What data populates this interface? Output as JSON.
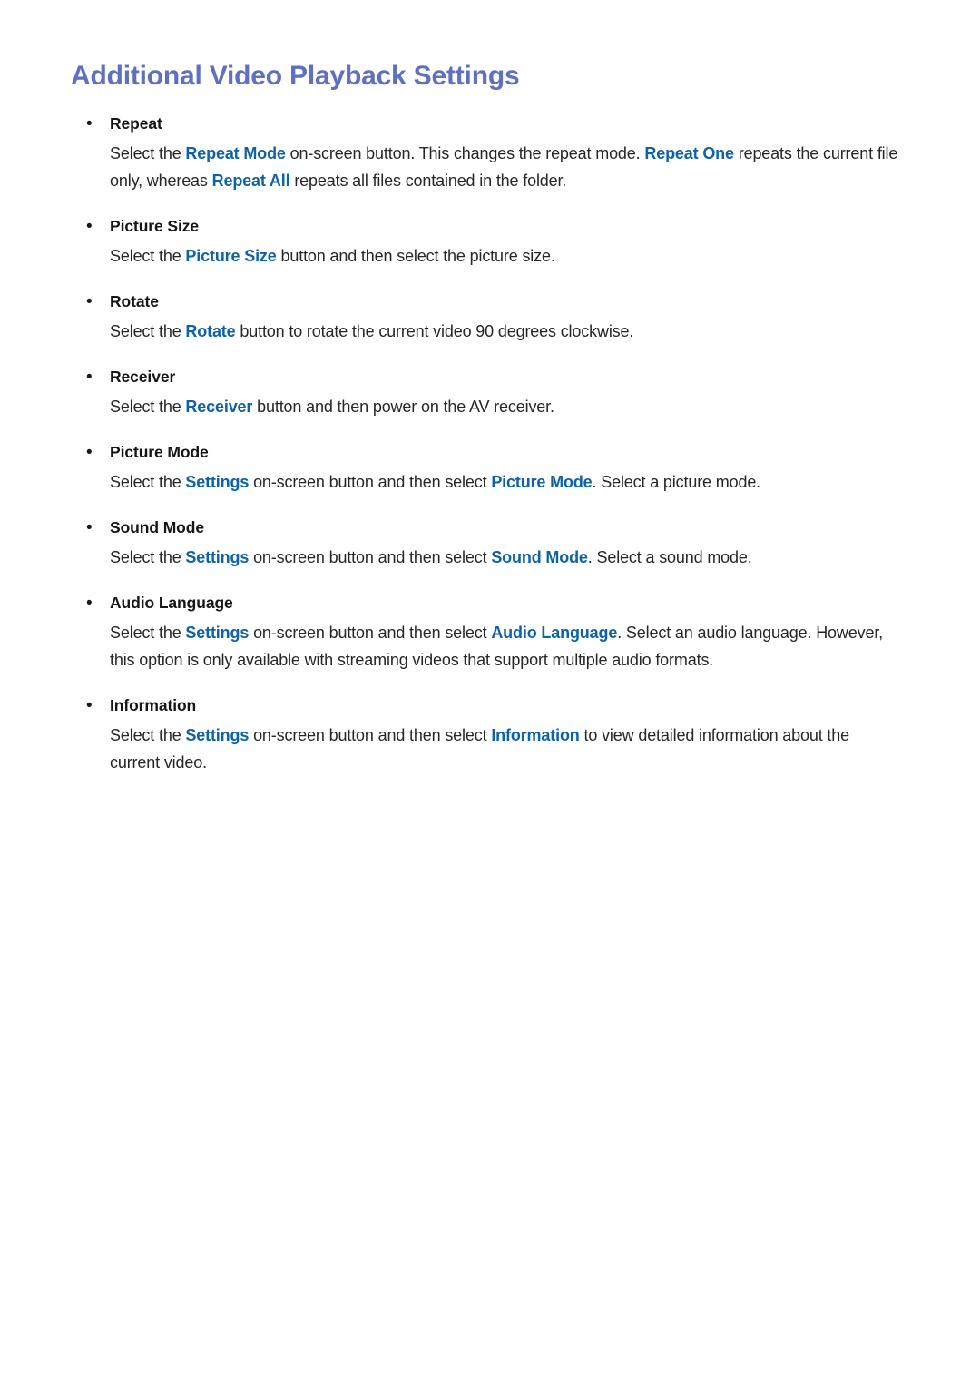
{
  "page": {
    "title": "Additional Video Playback Settings",
    "background_color": "#ffffff",
    "title_color": "#5f70c3",
    "term_color": "#0d62ab",
    "body_color": "#272727",
    "bullet_glyph": "•"
  },
  "sections": [
    {
      "label": "Repeat",
      "paragraph_parts": [
        {
          "text": "Select the ",
          "type": "plain"
        },
        {
          "text": "Repeat Mode",
          "type": "term"
        },
        {
          "text": " on-screen button. This changes the repeat mode. ",
          "type": "plain"
        },
        {
          "text": "Repeat One",
          "type": "term"
        },
        {
          "text": " repeats the current file only, whereas ",
          "type": "plain"
        },
        {
          "text": "Repeat All",
          "type": "term"
        },
        {
          "text": " repeats all files contained in the folder.",
          "type": "plain"
        }
      ],
      "paragraph_text": "Select the Repeat Mode on-screen button. This changes the repeat mode. Repeat One repeats the current file only, whereas Repeat All repeats all files contained in the folder."
    },
    {
      "label": "Picture Size",
      "paragraph_parts": [
        {
          "text": "Select the ",
          "type": "plain"
        },
        {
          "text": "Picture Size",
          "type": "term"
        },
        {
          "text": " button and then select the picture size.",
          "type": "plain"
        }
      ],
      "paragraph_text": "Select the Picture Size button and then select the picture size."
    },
    {
      "label": "Rotate",
      "paragraph_parts": [
        {
          "text": "Select the ",
          "type": "plain"
        },
        {
          "text": "Rotate",
          "type": "term"
        },
        {
          "text": " button to rotate the current video 90 degrees clockwise.",
          "type": "plain"
        }
      ],
      "paragraph_text": "Select the Rotate button to rotate the current video 90 degrees clockwise."
    },
    {
      "label": "Receiver",
      "paragraph_parts": [
        {
          "text": "Select the ",
          "type": "plain"
        },
        {
          "text": "Receiver",
          "type": "term"
        },
        {
          "text": " button and then power on the AV receiver.",
          "type": "plain"
        }
      ],
      "paragraph_text": "Select the Receiver button and then power on the AV receiver."
    },
    {
      "label": "Picture Mode",
      "paragraph_parts": [
        {
          "text": "Select the ",
          "type": "plain"
        },
        {
          "text": "Settings",
          "type": "term"
        },
        {
          "text": " on-screen button and then select ",
          "type": "plain"
        },
        {
          "text": "Picture Mode",
          "type": "term"
        },
        {
          "text": ". Select a picture mode.",
          "type": "plain"
        }
      ],
      "paragraph_text": "Select the Settings on-screen button and then select Picture Mode. Select a picture mode."
    },
    {
      "label": "Sound Mode",
      "paragraph_parts": [
        {
          "text": "Select the ",
          "type": "plain"
        },
        {
          "text": "Settings",
          "type": "term"
        },
        {
          "text": " on-screen button and then select ",
          "type": "plain"
        },
        {
          "text": "Sound Mode",
          "type": "term"
        },
        {
          "text": ". Select a sound mode.",
          "type": "plain"
        }
      ],
      "paragraph_text": "Select the Settings on-screen button and then select Sound Mode. Select a sound mode."
    },
    {
      "label": "Audio Language",
      "paragraph_parts": [
        {
          "text": "Select the ",
          "type": "plain"
        },
        {
          "text": "Settings",
          "type": "term"
        },
        {
          "text": " on-screen button and then select ",
          "type": "plain"
        },
        {
          "text": "Audio Language",
          "type": "term"
        },
        {
          "text": ". Select an audio language. However, this option is only available with streaming videos that support multiple audio formats.",
          "type": "plain"
        }
      ],
      "paragraph_text": "Select the Settings on-screen button and then select Audio Language. Select an audio language. However, this option is only available with streaming videos that support multiple audio formats."
    },
    {
      "label": "Information",
      "paragraph_parts": [
        {
          "text": "Select the ",
          "type": "plain"
        },
        {
          "text": "Settings",
          "type": "term"
        },
        {
          "text": " on-screen button and then select ",
          "type": "plain"
        },
        {
          "text": "Information",
          "type": "term"
        },
        {
          "text": " to view detailed information about the current video.",
          "type": "plain"
        }
      ],
      "paragraph_text": "Select the Settings on-screen button and then select Information to view detailed information about the current video."
    }
  ]
}
